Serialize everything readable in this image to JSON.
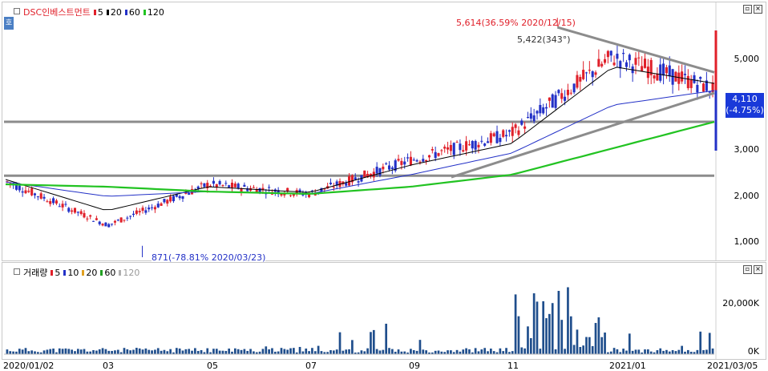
{
  "price_pane": {
    "legend": {
      "name": "DSC인베스트먼트",
      "ma": [
        {
          "label": "5",
          "color": "#e0202a"
        },
        {
          "label": "20",
          "color": "#000000"
        },
        {
          "label": "60",
          "color": "#2331c7"
        },
        {
          "label": "120",
          "color": "#22c322"
        }
      ]
    },
    "axis_labels": [
      "5,000",
      "4,000",
      "3,000",
      "2,000",
      "1,000"
    ],
    "annotation_high": "5,614(36.59% 2020/12/15)",
    "annotation_secondary": "5,422(343°)",
    "annotation_low": "871(-78.81% 2020/03/23)",
    "current_price": "4,110",
    "current_change": "(-4.75%)"
  },
  "volume_pane": {
    "legend": {
      "name": "거래량",
      "ma": [
        {
          "label": "5",
          "color": "#e0202a"
        },
        {
          "label": "10",
          "color": "#2331c7"
        },
        {
          "label": "20",
          "color": "#e0a020"
        },
        {
          "label": "60",
          "color": "#22a022"
        },
        {
          "label": "120",
          "color": "#b0b0b0"
        }
      ]
    },
    "axis_labels": [
      "20,000K",
      "0K"
    ]
  },
  "dates": [
    "2020/01/02",
    "03",
    "05",
    "07",
    "09",
    "11",
    "2021/01",
    "2021/03/05"
  ],
  "side_button": "호",
  "colors": {
    "up": "#e0202a",
    "down": "#2331c7",
    "ma120": "#22c322",
    "ma60": "#2331c7",
    "ma20": "#000000",
    "trendline": "#8c8c8c",
    "volume": "#1f4e8c"
  },
  "chart_data": {
    "type": "line",
    "title": "DSC인베스트먼트",
    "x": [
      "2020/01/02",
      "2020/03",
      "2020/05",
      "2020/07",
      "2020/09",
      "2020/11",
      "2021/01",
      "2021/03/05"
    ],
    "series": [
      {
        "name": "5",
        "values": [
          2200,
          1300,
          2150,
          1950,
          2650,
          3200,
          4800,
          4150
        ]
      },
      {
        "name": "20",
        "values": [
          2250,
          1600,
          2100,
          1980,
          2550,
          3000,
          4600,
          4250
        ]
      },
      {
        "name": "60",
        "values": [
          2200,
          1900,
          2000,
          1950,
          2350,
          2800,
          3800,
          4100
        ]
      },
      {
        "name": "120",
        "values": [
          2150,
          2100,
          2000,
          1950,
          2100,
          2350,
          2900,
          3450
        ]
      }
    ],
    "ylim": [
      700,
      5800
    ],
    "high": {
      "value": 5614,
      "date": "2020/12/15"
    },
    "low": {
      "value": 871,
      "date": "2020/03/23"
    },
    "last": 4110
  }
}
